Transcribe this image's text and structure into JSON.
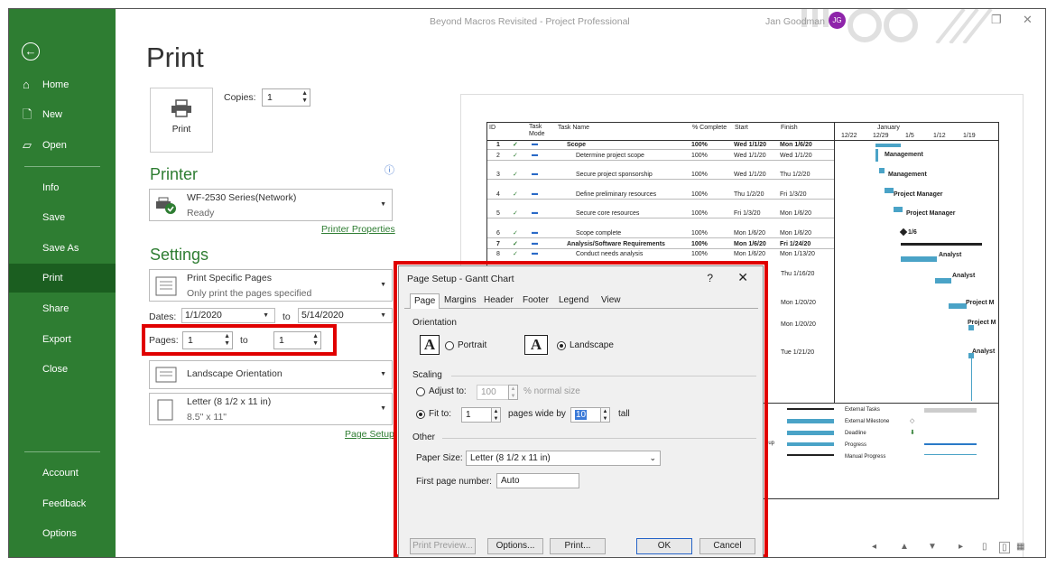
{
  "window": {
    "title": "Beyond Macros Revisited - Project Professional",
    "user_name": "Jan Goodman",
    "user_initials": "JG"
  },
  "sidebar": {
    "back_icon": "back-arrow-icon",
    "items": [
      {
        "label": "Home",
        "icon": "home-icon"
      },
      {
        "label": "New",
        "icon": "new-document-icon"
      },
      {
        "label": "Open",
        "icon": "open-folder-icon"
      },
      {
        "label": "Info"
      },
      {
        "label": "Save"
      },
      {
        "label": "Save As"
      },
      {
        "label": "Print"
      },
      {
        "label": "Share"
      },
      {
        "label": "Export"
      },
      {
        "label": "Close"
      }
    ],
    "bottom_items": [
      {
        "label": "Account"
      },
      {
        "label": "Feedback"
      },
      {
        "label": "Options"
      }
    ],
    "active": "Print"
  },
  "print": {
    "heading": "Print",
    "print_button_label": "Print",
    "copies_label": "Copies:",
    "copies_value": "1",
    "printer_heading": "Printer",
    "printer_name": "WF-2530 Series(Network)",
    "printer_status": "Ready",
    "printer_properties_link": "Printer Properties",
    "settings_heading": "Settings",
    "range_main": "Print Specific Pages",
    "range_sub": "Only print the pages specified",
    "dates_label": "Dates:",
    "date_from": "1/1/2020",
    "date_to_label": "to",
    "date_to": "5/14/2020",
    "pages_label": "Pages:",
    "pages_from": "1",
    "pages_to_label": "to",
    "pages_to": "1",
    "orientation": "Landscape Orientation",
    "paper_main": "Letter (8 1/2 x 11 in)",
    "paper_sub": "8.5\" x 11\"",
    "page_setup_link": "Page Setup"
  },
  "preview": {
    "headers": {
      "id": "ID",
      "task_mode": "Task Mode",
      "task_name": "Task Name",
      "complete": "% Complete",
      "start": "Start",
      "finish": "Finish",
      "month": "January",
      "weeks": [
        "12/22",
        "12/29",
        "1/5",
        "1/12",
        "1/19"
      ]
    },
    "rows": [
      {
        "id": "1",
        "name": "Scope",
        "complete": "100%",
        "start": "Wed 1/1/20",
        "finish": "Mon 1/6/20",
        "bold": true
      },
      {
        "id": "2",
        "name": "Determine project scope",
        "complete": "100%",
        "start": "Wed 1/1/20",
        "finish": "Wed 1/1/20"
      },
      {
        "id": "3",
        "name": "Secure project sponsorship",
        "complete": "100%",
        "start": "Wed 1/1/20",
        "finish": "Thu 1/2/20"
      },
      {
        "id": "4",
        "name": "Define preliminary resources",
        "complete": "100%",
        "start": "Thu 1/2/20",
        "finish": "Fri 1/3/20"
      },
      {
        "id": "5",
        "name": "Secure core resources",
        "complete": "100%",
        "start": "Fri 1/3/20",
        "finish": "Mon 1/6/20"
      },
      {
        "id": "6",
        "name": "Scope complete",
        "complete": "100%",
        "start": "Mon 1/6/20",
        "finish": "Mon 1/6/20"
      },
      {
        "id": "7",
        "name": "Analysis/Software Requirements",
        "complete": "100%",
        "start": "Mon 1/6/20",
        "finish": "Fri 1/24/20",
        "bold": true
      },
      {
        "id": "8",
        "name": "Conduct needs analysis",
        "complete": "100%",
        "start": "Mon 1/6/20",
        "finish": "Mon 1/13/20"
      }
    ],
    "finish_extra": [
      "Thu 1/16/20",
      "Mon 1/20/20",
      "Mon 1/20/20",
      "Tue 1/21/20"
    ],
    "gantt_labels": [
      "Management",
      "Management",
      "Project Manager",
      "Project Manager",
      "1/6",
      "Analyst",
      "Analyst",
      "Project M",
      "Project M",
      "Analyst"
    ],
    "legend": [
      "External Tasks",
      "External Milestone",
      "Deadline",
      "Progress",
      "Manual Progress"
    ],
    "legend_partial": "Rup"
  },
  "dialog": {
    "title": "Page Setup - Gantt Chart",
    "help": "?",
    "close": "✕",
    "tabs": [
      "Page",
      "Margins",
      "Header",
      "Footer",
      "Legend",
      "View"
    ],
    "orientation_label": "Orientation",
    "portrait_label": "Portrait",
    "landscape_label": "Landscape",
    "orientation_selected": "Landscape",
    "scaling_label": "Scaling",
    "adjust_label": "Adjust to:",
    "adjust_value": "100",
    "adjust_suffix": "% normal size",
    "fit_label": "Fit to:",
    "fit_wide": "1",
    "fit_wide_suffix": "pages wide by",
    "fit_tall": "10",
    "fit_tall_suffix": "tall",
    "scaling_selected": "Fit to",
    "other_label": "Other",
    "paper_size_label": "Paper Size:",
    "paper_size_value": "Letter (8 1/2 x 11 in)",
    "first_page_label": "First page number:",
    "first_page_value": "Auto",
    "buttons": {
      "preview": "Print Preview...",
      "options": "Options...",
      "print": "Print...",
      "ok": "OK",
      "cancel": "Cancel"
    }
  },
  "colors": {
    "sidebar": "#2e7d32",
    "sidebar_active": "#1b5e20",
    "highlight": "#e00000",
    "accent": "#2e7d32"
  }
}
